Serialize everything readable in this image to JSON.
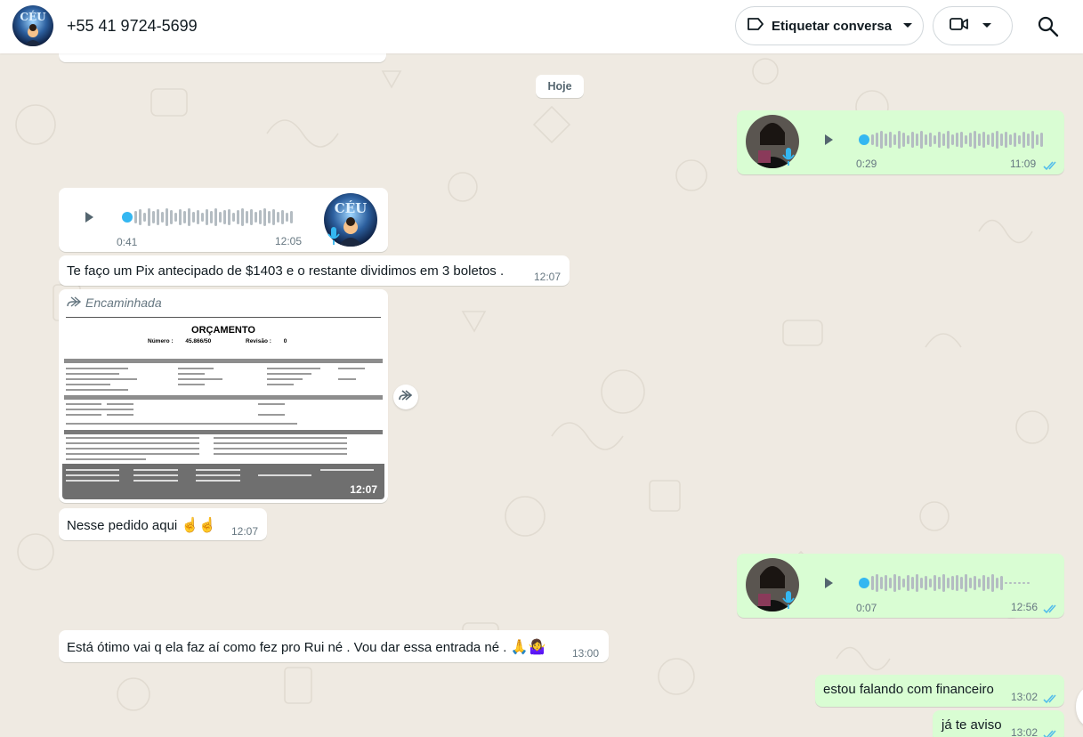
{
  "header": {
    "contact_name": "+55 41 9724-5699",
    "label_button": "Etiquetar conversa",
    "avatar_text": "CÉU"
  },
  "chat": {
    "date_chip": "Hoje",
    "messages": [
      {
        "type": "voice",
        "direction": "out",
        "duration": "0:29",
        "time": "11:09",
        "status": "read"
      },
      {
        "type": "voice",
        "direction": "in",
        "duration": "0:41",
        "time": "12:05"
      },
      {
        "type": "text",
        "direction": "in",
        "text": "Te faço um Pix antecipado de $1403 e o restante dividimos em 3 boletos .",
        "time": "12:07"
      },
      {
        "type": "image",
        "direction": "in",
        "forwarded_label": "Encaminhada",
        "time": "12:07",
        "document": {
          "title": "ORÇAMENTO",
          "number_label": "Número :",
          "number_value": "45.866/50",
          "revision_label": "Revisão :",
          "revision_value": "0"
        }
      },
      {
        "type": "text",
        "direction": "in",
        "text": "Nesse pedido aqui",
        "emoji": "☝️☝️",
        "time": "12:07"
      },
      {
        "type": "voice",
        "direction": "out",
        "duration": "0:07",
        "time": "12:56",
        "status": "read"
      },
      {
        "type": "text",
        "direction": "in",
        "text": "Está ótimo vai q ela faz aí como fez pro Rui né . Vou dar essa entrada né .",
        "emoji": "🙏🤷‍♀️",
        "time": "13:00"
      },
      {
        "type": "text",
        "direction": "out",
        "text": "estou falando com financeiro",
        "time": "13:02",
        "status": "read"
      },
      {
        "type": "text",
        "direction": "out",
        "text": "já te aviso",
        "time": "13:02",
        "status": "read"
      }
    ]
  },
  "colors": {
    "incoming_bubble": "#ffffff",
    "outgoing_bubble": "#d9fdd3",
    "chat_background": "#efeae2",
    "read_ticks": "#53bdeb",
    "voice_accent": "#34b7f1"
  },
  "icons": {
    "label": "label-tag-icon",
    "video": "video-camera-icon",
    "search": "search-icon",
    "play": "play-icon",
    "mic": "microphone-icon",
    "forward": "forward-icon",
    "ticks": "double-check-icon"
  }
}
